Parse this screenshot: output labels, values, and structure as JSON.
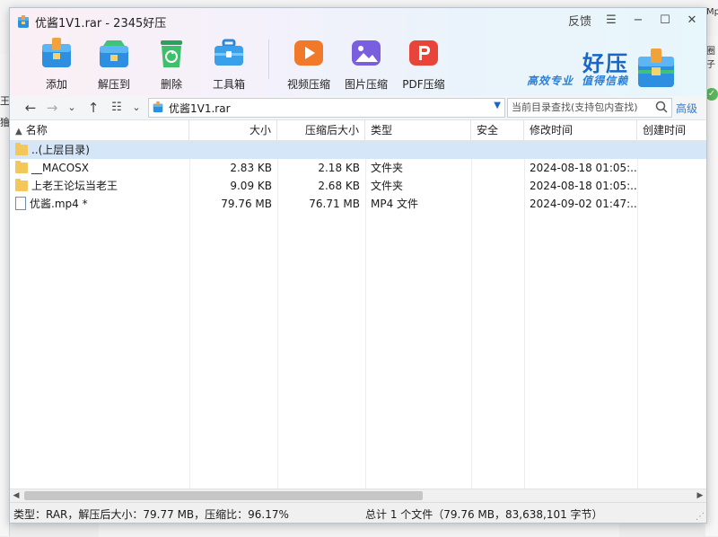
{
  "background": {
    "left_fragment_1": "王",
    "left_fragment_2": "獪",
    "right_fragment_1": "Mp4",
    "right_fragment_2": "圈子"
  },
  "window": {
    "title": "优酱1V1.rar - 2345好压",
    "controls": {
      "feedback": "反馈",
      "menu": "☰",
      "minimize": "−",
      "maximize": "☐",
      "close": "✕"
    }
  },
  "toolbar": {
    "items": [
      {
        "label": "添加",
        "icon": "add-archive-icon",
        "color": "#2e8fe0"
      },
      {
        "label": "解压到",
        "icon": "extract-icon",
        "color": "#2e8fe0"
      },
      {
        "label": "删除",
        "icon": "recycle-icon",
        "color": "#3dbf6b"
      },
      {
        "label": "工具箱",
        "icon": "toolbox-icon",
        "color": "#3aa0ea"
      },
      {
        "label": "视频压缩",
        "icon": "video-compress-icon",
        "color": "#f07a2a"
      },
      {
        "label": "图片压缩",
        "icon": "image-compress-icon",
        "color": "#7a5ee0"
      },
      {
        "label": "PDF压缩",
        "icon": "pdf-compress-icon",
        "color": "#e8443a"
      }
    ]
  },
  "brand": {
    "title": "好压",
    "slogan": "高效专业  值得信赖"
  },
  "addressbar": {
    "path": "优酱1V1.rar",
    "search_placeholder": "当前目录查找(支持包内查找)",
    "advanced": "高级"
  },
  "table": {
    "columns": [
      "名称",
      "大小",
      "压缩后大小",
      "类型",
      "安全",
      "修改时间",
      "创建时间"
    ],
    "rows": [
      {
        "name": "..(上层目录)",
        "size": "",
        "packed": "",
        "type": "",
        "security": "",
        "modified": "",
        "created": "",
        "kind": "folder",
        "selected": true
      },
      {
        "name": "__MACOSX",
        "size": "2.83 KB",
        "packed": "2.18 KB",
        "type": "文件夹",
        "security": "",
        "modified": "2024-08-18 01:05:...",
        "created": "",
        "kind": "folder",
        "selected": false
      },
      {
        "name": "上老王论坛当老王",
        "size": "9.09 KB",
        "packed": "2.68 KB",
        "type": "文件夹",
        "security": "",
        "modified": "2024-08-18 01:05:...",
        "created": "",
        "kind": "folder",
        "selected": false
      },
      {
        "name": "优酱.mp4 *",
        "size": "79.76 MB",
        "packed": "76.71 MB",
        "type": "MP4 文件",
        "security": "",
        "modified": "2024-09-02 01:47:...",
        "created": "",
        "kind": "file",
        "selected": false
      }
    ]
  },
  "status": {
    "left": "类型：RAR，解压后大小：79.77 MB，压缩比：96.17%",
    "right": "总计 1 个文件（79.76 MB，83,638,101 字节）"
  }
}
